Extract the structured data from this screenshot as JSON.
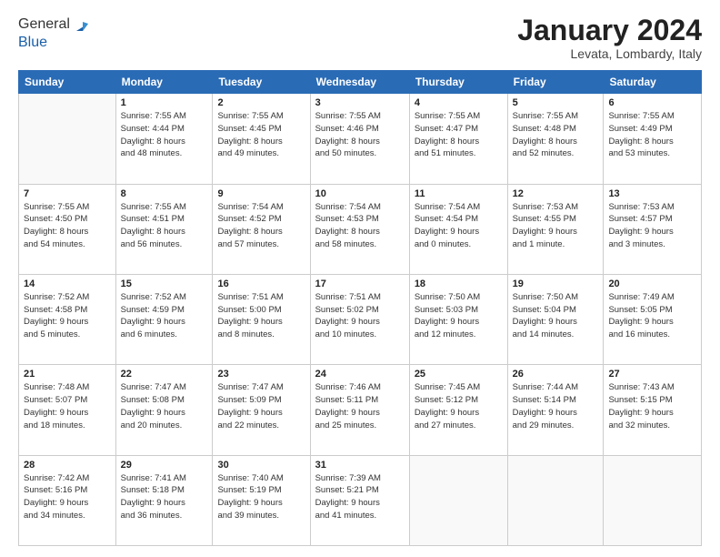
{
  "header": {
    "logo_line1": "General",
    "logo_line2": "Blue",
    "month_title": "January 2024",
    "location": "Levata, Lombardy, Italy"
  },
  "days_of_week": [
    "Sunday",
    "Monday",
    "Tuesday",
    "Wednesday",
    "Thursday",
    "Friday",
    "Saturday"
  ],
  "weeks": [
    [
      {
        "day": "",
        "info": ""
      },
      {
        "day": "1",
        "info": "Sunrise: 7:55 AM\nSunset: 4:44 PM\nDaylight: 8 hours\nand 48 minutes."
      },
      {
        "day": "2",
        "info": "Sunrise: 7:55 AM\nSunset: 4:45 PM\nDaylight: 8 hours\nand 49 minutes."
      },
      {
        "day": "3",
        "info": "Sunrise: 7:55 AM\nSunset: 4:46 PM\nDaylight: 8 hours\nand 50 minutes."
      },
      {
        "day": "4",
        "info": "Sunrise: 7:55 AM\nSunset: 4:47 PM\nDaylight: 8 hours\nand 51 minutes."
      },
      {
        "day": "5",
        "info": "Sunrise: 7:55 AM\nSunset: 4:48 PM\nDaylight: 8 hours\nand 52 minutes."
      },
      {
        "day": "6",
        "info": "Sunrise: 7:55 AM\nSunset: 4:49 PM\nDaylight: 8 hours\nand 53 minutes."
      }
    ],
    [
      {
        "day": "7",
        "info": "Sunrise: 7:55 AM\nSunset: 4:50 PM\nDaylight: 8 hours\nand 54 minutes."
      },
      {
        "day": "8",
        "info": "Sunrise: 7:55 AM\nSunset: 4:51 PM\nDaylight: 8 hours\nand 56 minutes."
      },
      {
        "day": "9",
        "info": "Sunrise: 7:54 AM\nSunset: 4:52 PM\nDaylight: 8 hours\nand 57 minutes."
      },
      {
        "day": "10",
        "info": "Sunrise: 7:54 AM\nSunset: 4:53 PM\nDaylight: 8 hours\nand 58 minutes."
      },
      {
        "day": "11",
        "info": "Sunrise: 7:54 AM\nSunset: 4:54 PM\nDaylight: 9 hours\nand 0 minutes."
      },
      {
        "day": "12",
        "info": "Sunrise: 7:53 AM\nSunset: 4:55 PM\nDaylight: 9 hours\nand 1 minute."
      },
      {
        "day": "13",
        "info": "Sunrise: 7:53 AM\nSunset: 4:57 PM\nDaylight: 9 hours\nand 3 minutes."
      }
    ],
    [
      {
        "day": "14",
        "info": "Sunrise: 7:52 AM\nSunset: 4:58 PM\nDaylight: 9 hours\nand 5 minutes."
      },
      {
        "day": "15",
        "info": "Sunrise: 7:52 AM\nSunset: 4:59 PM\nDaylight: 9 hours\nand 6 minutes."
      },
      {
        "day": "16",
        "info": "Sunrise: 7:51 AM\nSunset: 5:00 PM\nDaylight: 9 hours\nand 8 minutes."
      },
      {
        "day": "17",
        "info": "Sunrise: 7:51 AM\nSunset: 5:02 PM\nDaylight: 9 hours\nand 10 minutes."
      },
      {
        "day": "18",
        "info": "Sunrise: 7:50 AM\nSunset: 5:03 PM\nDaylight: 9 hours\nand 12 minutes."
      },
      {
        "day": "19",
        "info": "Sunrise: 7:50 AM\nSunset: 5:04 PM\nDaylight: 9 hours\nand 14 minutes."
      },
      {
        "day": "20",
        "info": "Sunrise: 7:49 AM\nSunset: 5:05 PM\nDaylight: 9 hours\nand 16 minutes."
      }
    ],
    [
      {
        "day": "21",
        "info": "Sunrise: 7:48 AM\nSunset: 5:07 PM\nDaylight: 9 hours\nand 18 minutes."
      },
      {
        "day": "22",
        "info": "Sunrise: 7:47 AM\nSunset: 5:08 PM\nDaylight: 9 hours\nand 20 minutes."
      },
      {
        "day": "23",
        "info": "Sunrise: 7:47 AM\nSunset: 5:09 PM\nDaylight: 9 hours\nand 22 minutes."
      },
      {
        "day": "24",
        "info": "Sunrise: 7:46 AM\nSunset: 5:11 PM\nDaylight: 9 hours\nand 25 minutes."
      },
      {
        "day": "25",
        "info": "Sunrise: 7:45 AM\nSunset: 5:12 PM\nDaylight: 9 hours\nand 27 minutes."
      },
      {
        "day": "26",
        "info": "Sunrise: 7:44 AM\nSunset: 5:14 PM\nDaylight: 9 hours\nand 29 minutes."
      },
      {
        "day": "27",
        "info": "Sunrise: 7:43 AM\nSunset: 5:15 PM\nDaylight: 9 hours\nand 32 minutes."
      }
    ],
    [
      {
        "day": "28",
        "info": "Sunrise: 7:42 AM\nSunset: 5:16 PM\nDaylight: 9 hours\nand 34 minutes."
      },
      {
        "day": "29",
        "info": "Sunrise: 7:41 AM\nSunset: 5:18 PM\nDaylight: 9 hours\nand 36 minutes."
      },
      {
        "day": "30",
        "info": "Sunrise: 7:40 AM\nSunset: 5:19 PM\nDaylight: 9 hours\nand 39 minutes."
      },
      {
        "day": "31",
        "info": "Sunrise: 7:39 AM\nSunset: 5:21 PM\nDaylight: 9 hours\nand 41 minutes."
      },
      {
        "day": "",
        "info": ""
      },
      {
        "day": "",
        "info": ""
      },
      {
        "day": "",
        "info": ""
      }
    ]
  ]
}
